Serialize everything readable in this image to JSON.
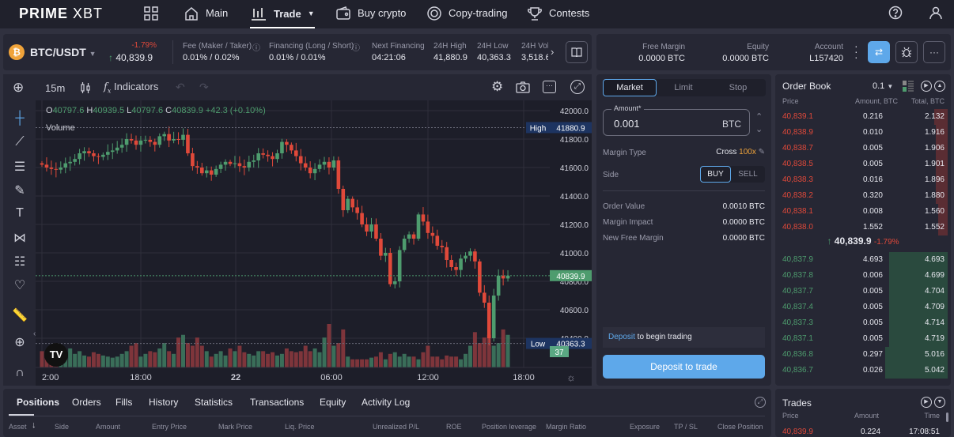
{
  "nav": {
    "logo": "PRIME XBT",
    "logo_bold": "PRIME",
    "logo_light": "XBT",
    "items": [
      {
        "label": "Main",
        "icon": "home-icon"
      },
      {
        "label": "Trade",
        "icon": "chart-icon",
        "active": true
      },
      {
        "label": "Buy crypto",
        "icon": "wallet-icon"
      },
      {
        "label": "Copy-trading",
        "icon": "copy-icon"
      },
      {
        "label": "Contests",
        "icon": "trophy-icon"
      }
    ]
  },
  "ticker": {
    "symbol": "BTC/USDT",
    "change": "-1.79%",
    "price": "40,839.9",
    "stats": [
      {
        "label": "Fee (Maker / Taker)",
        "value": "0.01% / 0.02%",
        "info": true
      },
      {
        "label": "Financing (Long / Short)",
        "value": "0.01% / 0.01%",
        "info": true
      },
      {
        "label": "Next Financing",
        "value": "04:21:06"
      },
      {
        "label": "24H High",
        "value": "41,880.9"
      },
      {
        "label": "24H Low",
        "value": "40,363.3"
      },
      {
        "label": "24H Vol",
        "value": "3,518.6"
      }
    ]
  },
  "account": {
    "free_margin_label": "Free Margin",
    "free_margin": "0.0000 BTC",
    "equity_label": "Equity",
    "equity": "0.0000 BTC",
    "account_label": "Account",
    "account": "L157420"
  },
  "chart_toolbar": {
    "interval": "15m",
    "indicators": "Indicators"
  },
  "chart": {
    "ohlc": {
      "o_label": "O",
      "o": "40797.6",
      "h_label": "H",
      "h": "40939.5",
      "l_label": "L",
      "l": "40797.6",
      "c_label": "C",
      "c": "40839.9",
      "change": "+42.3 (+0.10%)"
    },
    "volume_label": "Volume",
    "price_ticks": [
      "42000.0",
      "41800.0",
      "41600.0",
      "41400.0",
      "41200.0",
      "41000.0",
      "40800.0",
      "40600.0",
      "40400.0"
    ],
    "price_tick_values": [
      42000,
      41800,
      41600,
      41400,
      41200,
      41000,
      40800,
      40600,
      40400
    ],
    "high_label": "High",
    "high": "41880.9",
    "low_label": "Low",
    "low": "40363.3",
    "last": "40839.9",
    "volume_last": "37",
    "time_ticks": [
      "2:00",
      "18:00",
      "22",
      "06:00",
      "12:00",
      "18:00"
    ],
    "up_color": "#4e9c6e",
    "down_color": "#e0493a",
    "closes": [
      41620,
      41600,
      41590,
      41585,
      41600,
      41630,
      41640,
      41660,
      41700,
      41715,
      41700,
      41680,
      41675,
      41690,
      41710,
      41720,
      41740,
      41760,
      41800,
      41790,
      41760,
      41790,
      41795,
      41780,
      41760,
      41820,
      41835,
      41790,
      41800,
      41795,
      41830,
      41700,
      41610,
      41600,
      41560,
      41580,
      41550,
      41590,
      41620,
      41640,
      41625,
      41630,
      41610,
      41600,
      41640,
      41650,
      41700,
      41690,
      41680,
      41660,
      41700,
      41780,
      41760,
      41720,
      41680,
      41630,
      41600,
      41560,
      41590,
      41620,
      41640,
      41600,
      41650,
      41450,
      41300,
      41380,
      41320,
      41280,
      41200,
      41150,
      41200,
      41100,
      40980,
      41000,
      40780,
      40800,
      41020,
      41100,
      41130,
      41100,
      41270,
      41220,
      41140,
      41120,
      41050,
      41040,
      40950,
      40900,
      40880,
      40960,
      40980,
      41010,
      40940,
      40720,
      40650,
      40400,
      40700,
      40840,
      40820,
      40840
    ],
    "volumes": [
      30,
      25,
      20,
      18,
      22,
      30,
      35,
      25,
      30,
      22,
      20,
      28,
      25,
      22,
      20,
      18,
      20,
      25,
      30,
      40,
      45,
      20,
      25,
      30,
      28,
      35,
      45,
      30,
      25,
      55,
      60,
      45,
      40,
      55,
      40,
      30,
      20,
      25,
      30,
      22,
      35,
      30,
      40,
      28,
      25,
      22,
      30,
      30,
      25,
      28,
      22,
      25,
      35,
      30,
      28,
      30,
      40,
      30,
      35,
      28,
      55,
      80,
      40,
      45,
      70,
      20,
      15,
      15,
      15,
      15,
      18,
      20,
      28,
      15,
      25,
      28,
      20,
      25,
      20,
      20,
      15,
      28,
      40,
      20,
      20,
      15,
      22,
      20,
      20,
      15,
      25,
      40,
      65,
      45,
      55,
      60,
      40,
      45,
      70,
      60
    ]
  },
  "order_form": {
    "tabs": [
      "Market",
      "Limit",
      "Stop"
    ],
    "amount_label": "Amount*",
    "amount": "0.001",
    "amount_unit": "BTC",
    "margin_type_label": "Margin Type",
    "margin_type": "Cross",
    "leverage": "100x",
    "side_label": "Side",
    "buy": "BUY",
    "sell": "SELL",
    "info": [
      {
        "label": "Order Value",
        "value": "0.0010 BTC"
      },
      {
        "label": "Margin Impact",
        "value": "0.0000 BTC"
      },
      {
        "label": "New Free Margin",
        "value": "0.0000 BTC"
      }
    ],
    "deposit_link": "Deposit",
    "deposit_note": " to begin trading",
    "deposit_button": "Deposit to trade"
  },
  "order_book": {
    "title": "Order Book",
    "step": "0.1",
    "cols": [
      "Price",
      "Amount, BTC",
      "Total, BTC"
    ],
    "asks": [
      [
        "40,839.1",
        "0.216",
        "2.132"
      ],
      [
        "40,838.9",
        "0.010",
        "1.916"
      ],
      [
        "40,838.7",
        "0.005",
        "1.906"
      ],
      [
        "40,838.5",
        "0.005",
        "1.901"
      ],
      [
        "40,838.3",
        "0.016",
        "1.896"
      ],
      [
        "40,838.2",
        "0.320",
        "1.880"
      ],
      [
        "40,838.1",
        "0.008",
        "1.560"
      ],
      [
        "40,838.0",
        "1.552",
        "1.552"
      ]
    ],
    "mid_price": "40,839.9",
    "mid_change": "-1.79%",
    "bids": [
      [
        "40,837.9",
        "4.693",
        "4.693"
      ],
      [
        "40,837.8",
        "0.006",
        "4.699"
      ],
      [
        "40,837.7",
        "0.005",
        "4.704"
      ],
      [
        "40,837.4",
        "0.005",
        "4.709"
      ],
      [
        "40,837.3",
        "0.005",
        "4.714"
      ],
      [
        "40,837.1",
        "0.005",
        "4.719"
      ],
      [
        "40,836.8",
        "0.297",
        "5.016"
      ],
      [
        "40,836.7",
        "0.026",
        "5.042"
      ]
    ]
  },
  "positions": {
    "tabs": [
      "Positions",
      "Orders",
      "Fills",
      "History",
      "Statistics",
      "Transactions",
      "Equity",
      "Activity Log"
    ],
    "cols": [
      "Asset",
      "Side",
      "Amount",
      "Entry Price",
      "Mark Price",
      "Liq. Price",
      "Unrealized P/L",
      "ROE",
      "Position leverage",
      "Margin Ratio",
      "Exposure",
      "TP / SL",
      "Close Position"
    ]
  },
  "trades": {
    "title": "Trades",
    "cols": [
      "Price",
      "Amount",
      "Time"
    ],
    "rows": [
      [
        "40,839.9",
        "0.224",
        "17:08:51"
      ]
    ]
  }
}
